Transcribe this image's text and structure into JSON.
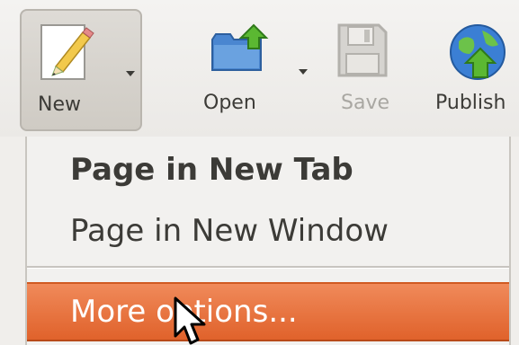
{
  "toolbar": {
    "new_label": "New",
    "open_label": "Open",
    "save_label": "Save",
    "publish_label": "Publish"
  },
  "menu": {
    "items": [
      {
        "label": "Page in New Tab",
        "bold": true
      },
      {
        "label": "Page in New Window",
        "bold": false
      },
      {
        "label": "More options...",
        "highlighted": true
      }
    ]
  },
  "colors": {
    "highlight": "#e9743c",
    "toolbar_bg": "#f0eeeb",
    "text": "#3c3b37",
    "disabled_text": "#a9a7a2"
  },
  "icons": {
    "new": "new-document-pencil-icon",
    "open": "folder-open-icon",
    "save": "floppy-save-icon",
    "publish": "globe-publish-icon"
  }
}
